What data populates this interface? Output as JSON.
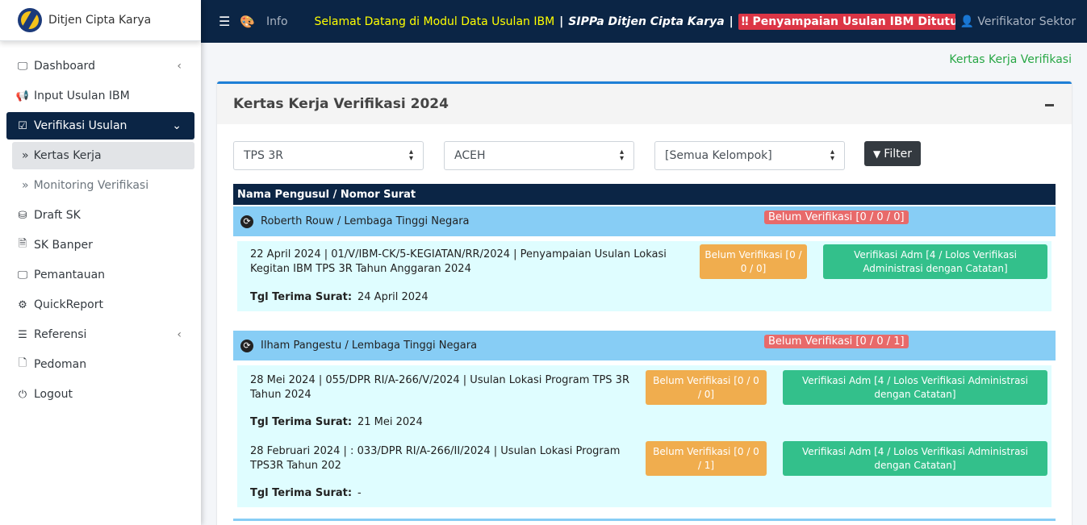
{
  "brand": {
    "name": "Ditjen Cipta Karya"
  },
  "sidebar": {
    "items": [
      {
        "label": "Dashboard",
        "icon": "monitor-icon",
        "arrow": "‹"
      },
      {
        "label": "Input Usulan IBM",
        "icon": "bullhorn-icon"
      },
      {
        "label": "Verifikasi Usulan",
        "icon": "check-square-icon",
        "arrow": "⌄"
      },
      {
        "label": "Draft SK",
        "icon": "database-icon"
      },
      {
        "label": "SK Banper",
        "icon": "file-text-icon"
      },
      {
        "label": "Pemantauan",
        "icon": "monitor-icon"
      },
      {
        "label": "QuickReport",
        "icon": "cogs-icon"
      },
      {
        "label": "Referensi",
        "icon": "list-icon",
        "arrow": "‹"
      },
      {
        "label": "Pedoman",
        "icon": "file-icon"
      },
      {
        "label": "Logout",
        "icon": "power-icon"
      }
    ],
    "subitems": [
      {
        "label": "Kertas Kerja"
      },
      {
        "label": "Monitoring Verifikasi"
      }
    ]
  },
  "topbar": {
    "info": "Info",
    "marquee_welcome": "Selamat Datang di Modul Data Usulan IBM",
    "sep": "|",
    "marquee_app": "SIPPa Ditjen Cipta Karya",
    "marquee_alert": "‼ Penyampaian Usulan IBM Ditutup Tangg",
    "user": "Verifikator Sektor"
  },
  "breadcrumb": "Kertas Kerja Verifikasi",
  "card": {
    "title": "Kertas Kerja Verifikasi 2024"
  },
  "filters": {
    "sector": "TPS 3R",
    "province": "ACEH",
    "group": "[Semua Kelompok]",
    "button": "Filter"
  },
  "table": {
    "header": "Nama Pengusul / Nomor Surat",
    "tgl_label": "Tgl Terima Surat:",
    "groups": [
      {
        "title": "Roberth Rouw / Lembaga Tinggi Negara",
        "status": "Belum Verifikasi [0 / 0 / 0]",
        "entries": [
          {
            "text": "22 April 2024 | 01/V/IBM-CK/5-KEGIATAN/RR/2024 | Penyampaian Usulan Lokasi Kegitan IBM TPS 3R Tahun Anggaran 2024",
            "orange": "Belum Verifikasi [0 / 0 / 0]",
            "green": "Verifikasi Adm [4 / Lolos Verifikasi Administrasi dengan Catatan]",
            "tgl": "24 April 2024"
          }
        ]
      },
      {
        "title": "Ilham Pangestu / Lembaga Tinggi Negara",
        "status": "Belum Verifikasi [0 / 0 / 1]",
        "entries": [
          {
            "text": "28 Mei 2024 | 055/DPR RI/A-266/V/2024 | Usulan Lokasi Program TPS 3R Tahun 2024",
            "orange": "Belum Verifikasi [0 / 0 / 0]",
            "green": "Verifikasi Adm [4 / Lolos Verifikasi Administrasi dengan Catatan]",
            "tgl": "21 Mei 2024"
          },
          {
            "text": "28 Februari 2024 | : 033/DPR RI/A-266/II/2024 | Usulan Lokasi Program TPS3R Tahun 202",
            "orange": "Belum Verifikasi [0 / 0 / 1]",
            "green": "Verifikasi Adm [4 / Lolos Verifikasi Administrasi dengan Catatan]",
            "tgl": "-"
          }
        ]
      }
    ]
  },
  "colors": {
    "navy": "#0b2545",
    "accent_blue": "#1e7fd6",
    "group_bg": "#87cdf5",
    "entry_bg": "#dffdff",
    "orange": "#f0ad4e",
    "green": "#33c08b",
    "red_badge": "#e86a6a",
    "breadcrumb_green": "#28a745"
  }
}
